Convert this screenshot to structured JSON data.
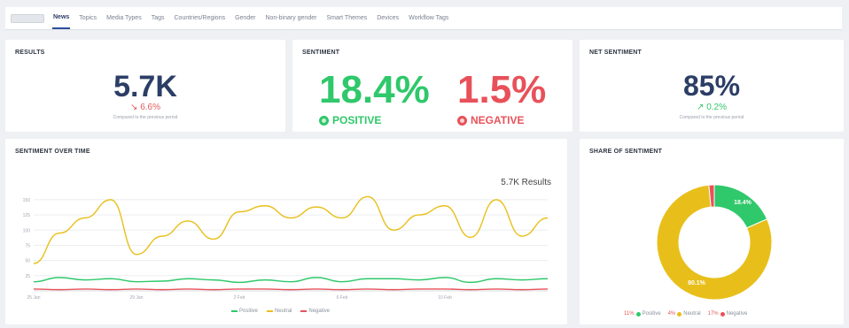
{
  "tabs": [
    {
      "label": "News",
      "active": true
    },
    {
      "label": "Topics"
    },
    {
      "label": "Media Types"
    },
    {
      "label": "Tags"
    },
    {
      "label": "Countries/Regions"
    },
    {
      "label": "Gender"
    },
    {
      "label": "Non-binary gender"
    },
    {
      "label": "Smart Themes"
    },
    {
      "label": "Devices"
    },
    {
      "label": "Workflow Tags"
    }
  ],
  "results": {
    "title": "RESULTS",
    "value": "5.7K",
    "delta": "6.6%",
    "caption": "Compared to the previous period"
  },
  "sentiment": {
    "title": "SENTIMENT",
    "positive_value": "18.4%",
    "positive_label": "POSITIVE",
    "negative_value": "1.5%",
    "negative_label": "NEGATIVE"
  },
  "net_sentiment": {
    "title": "NET SENTIMENT",
    "value": "85%",
    "delta": "0.2%",
    "caption": "Compared to the previous period"
  },
  "over_time": {
    "title": "SENTIMENT OVER TIME",
    "results_label": "5.7K Results",
    "y_ticks": [
      "150",
      "125",
      "100",
      "75",
      "50",
      "25"
    ],
    "x_ticks": [
      "25 Jan",
      "29 Jan",
      "2 Feb",
      "6 Feb",
      "10 Feb"
    ],
    "legend": [
      "Positive",
      "Neutral",
      "Negative"
    ]
  },
  "share": {
    "title": "SHARE OF SENTIMENT",
    "positive_label": "18.4%",
    "neutral_label": "80.1%",
    "legend": [
      {
        "pct": "11%",
        "name": "Positive"
      },
      {
        "pct": "4%",
        "name": "Neutral"
      },
      {
        "pct": "17%",
        "name": "Negative"
      }
    ]
  },
  "colors": {
    "positive": "#2fc86a",
    "neutral": "#e8bf1a",
    "negative": "#e8515a",
    "navy": "#2c3e66"
  },
  "chart_data": [
    {
      "type": "line",
      "title": "SENTIMENT OVER TIME",
      "x": [
        "25 Jan",
        "26 Jan",
        "27 Jan",
        "28 Jan",
        "29 Jan",
        "30 Jan",
        "31 Jan",
        "1 Feb",
        "2 Feb",
        "3 Feb",
        "4 Feb",
        "5 Feb",
        "6 Feb",
        "7 Feb",
        "8 Feb",
        "9 Feb",
        "10 Feb",
        "11 Feb",
        "12 Feb",
        "13 Feb",
        "14 Feb"
      ],
      "ylim": [
        0,
        160
      ],
      "grid": true,
      "legend_position": "bottom",
      "series": [
        {
          "name": "Neutral",
          "values": [
            45,
            95,
            120,
            150,
            60,
            90,
            115,
            85,
            130,
            140,
            120,
            138,
            120,
            155,
            100,
            125,
            140,
            88,
            150,
            90,
            120
          ]
        },
        {
          "name": "Positive",
          "values": [
            15,
            22,
            18,
            20,
            15,
            16,
            20,
            18,
            14,
            18,
            15,
            22,
            15,
            20,
            20,
            18,
            22,
            14,
            20,
            18,
            20
          ]
        },
        {
          "name": "Negative",
          "values": [
            3,
            2,
            3,
            2,
            3,
            2,
            3,
            2,
            3,
            3,
            2,
            3,
            2,
            3,
            2,
            3,
            3,
            2,
            3,
            2,
            3
          ]
        }
      ]
    },
    {
      "type": "pie",
      "title": "SHARE OF SENTIMENT",
      "categories": [
        "Positive",
        "Neutral",
        "Negative"
      ],
      "values": [
        18.4,
        80.1,
        1.5
      ]
    }
  ]
}
